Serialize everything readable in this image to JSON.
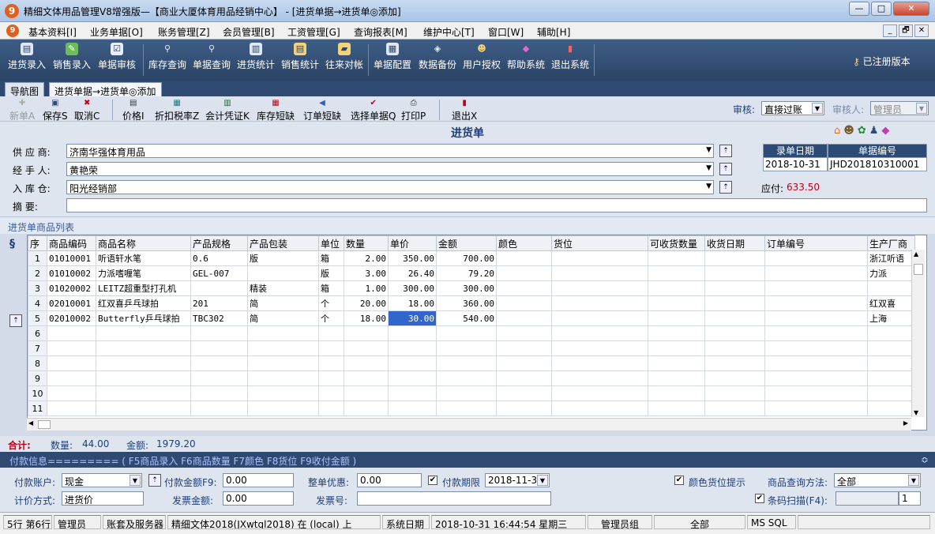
{
  "window": {
    "title": "精细文体用品管理V8增强版—【商业大厦体育用品经销中心】 - [进货单据→进货单◎添加]",
    "btn_min": "—",
    "btn_max": "□",
    "btn_close": "✕"
  },
  "menu": {
    "items": [
      "基本资料[I]",
      "业务单据[O]",
      "账务管理[Z]",
      "会员管理[B]",
      "工资管理[G]",
      "查询报表[M]",
      "维护中心[T]",
      "窗口[W]",
      "辅助[H]"
    ],
    "mdi_min": "_",
    "mdi_restore": "🗗",
    "mdi_close": "✕"
  },
  "main_toolbar": {
    "items": [
      "进货录入",
      "销售录入",
      "单据审核",
      "库存查询",
      "单据查询",
      "进货统计",
      "销售统计",
      "往来对帐",
      "单据配置",
      "数据备份",
      "用户授权",
      "帮助系统",
      "退出系统"
    ],
    "registered": "已注册版本"
  },
  "tabs": {
    "nav": "导航图",
    "current": "进货单据→进货单◎添加"
  },
  "sub_toolbar": {
    "items": [
      "新单A",
      "保存S",
      "取消C",
      "价格I",
      "折扣税率Z",
      "会计凭证K",
      "库存短缺",
      "订单短缺",
      "选择单据Q",
      "打印P",
      "退出X"
    ],
    "audit_label": "审核:",
    "audit_value": "直接过账",
    "auditor_label": "审核人:",
    "auditor_value": "管理员"
  },
  "form": {
    "title": "进货单",
    "supplier_label": "供 应 商:",
    "supplier_value": "济南华强体育用品",
    "handler_label": "经 手 人:",
    "handler_value": "黄艳荣",
    "warehouse_label": "入 库 仓:",
    "warehouse_value": "阳光经销部",
    "summary_label": "摘    要:",
    "summary_value": "",
    "date_header": "录单日期",
    "date_value": "2018-10-31",
    "number_header": "单据编号",
    "number_value": "JHD201810310001",
    "payable_label": "应付:",
    "payable_value": "633.50"
  },
  "list": {
    "caption": "进货单商品列表",
    "columns": [
      "序",
      "商品编码",
      "商品名称",
      "产品规格",
      "产品包装",
      "单位",
      "数量",
      "单价",
      "金额",
      "颜色",
      "货位",
      "可收货数量",
      "收货日期",
      "订单编号",
      "生产厂商"
    ],
    "rows": [
      [
        "1",
        "01010001",
        "听语轩水笔",
        "0.6",
        "版",
        "箱",
        "2.00",
        "350.00",
        "700.00",
        "",
        "",
        "",
        "",
        "",
        "浙江听语"
      ],
      [
        "2",
        "01010002",
        "力派嗜喱笔",
        "GEL-007",
        "",
        "版",
        "3.00",
        "26.40",
        "79.20",
        "",
        "",
        "",
        "",
        "",
        "力派"
      ],
      [
        "3",
        "01020002",
        "LEITZ超重型打孔机",
        "",
        "精装",
        "箱",
        "1.00",
        "300.00",
        "300.00",
        "",
        "",
        "",
        "",
        "",
        ""
      ],
      [
        "4",
        "02010001",
        "红双喜乒乓球拍",
        "201",
        "简",
        "个",
        "20.00",
        "18.00",
        "360.00",
        "",
        "",
        "",
        "",
        "",
        "红双喜"
      ],
      [
        "5",
        "02010002",
        "Butterfly乒乓球拍",
        "TBC302",
        "简",
        "个",
        "18.00",
        "30.00",
        "540.00",
        "",
        "",
        "",
        "",
        "",
        "上海"
      ],
      [
        "6",
        "",
        "",
        "",
        "",
        "",
        "",
        "",
        "",
        "",
        "",
        "",
        "",
        "",
        ""
      ],
      [
        "7",
        "",
        "",
        "",
        "",
        "",
        "",
        "",
        "",
        "",
        "",
        "",
        "",
        "",
        ""
      ],
      [
        "8",
        "",
        "",
        "",
        "",
        "",
        "",
        "",
        "",
        "",
        "",
        "",
        "",
        "",
        ""
      ],
      [
        "9",
        "",
        "",
        "",
        "",
        "",
        "",
        "",
        "",
        "",
        "",
        "",
        "",
        "",
        ""
      ],
      [
        "10",
        "",
        "",
        "",
        "",
        "",
        "",
        "",
        "",
        "",
        "",
        "",
        "",
        "",
        ""
      ],
      [
        "11",
        "",
        "",
        "",
        "",
        "",
        "",
        "",
        "",
        "",
        "",
        "",
        "",
        "",
        ""
      ]
    ]
  },
  "totals": {
    "label": "合计:",
    "qty_label": "数量:",
    "qty_value": "44.00",
    "amount_label": "金额:",
    "amount_value": "1979.20"
  },
  "payment": {
    "header": "付款信息========= ( F5商品录入 F6商品数量 F7颜色 F8货位 F9收付金额 )",
    "account_label": "付款账户:",
    "account_value": "现金",
    "amount_label": "付款金额F9:",
    "amount_value": "0.00",
    "discount_label": "整单优惠:",
    "discount_value": "0.00",
    "term_label": "付款期限",
    "term_value": "2018-11-30",
    "pricing_label": "计价方式:",
    "pricing_value": "进货价",
    "invoice_amount_label": "发票金额:",
    "invoice_amount_value": "0.00",
    "invoice_no_label": "发票号:",
    "invoice_no_value": "",
    "color_hint_label": "颜色货位提示",
    "query_method_label": "商品查询方法:",
    "query_method_value": "全部",
    "barcode_label": "条码扫描(F4):",
    "barcode_count": "1"
  },
  "status": {
    "row_info": "5行 第6行",
    "user": "管理员",
    "account_set_label": "账套及服务器",
    "account_set_value": "精细文体2018(JXwtgl2018) 在 (local) 上",
    "sys_date_label": "系统日期",
    "sys_date_value": "2018-10-31   16:44:54   星期三",
    "group": "管理员组",
    "scope": "全部",
    "db": "MS SQL"
  },
  "colors": {
    "toolbar_bg": "#2f4a70",
    "header_cell": "#2c4a74",
    "payable": "#c0001a",
    "selected_cell": "#3366cc"
  }
}
